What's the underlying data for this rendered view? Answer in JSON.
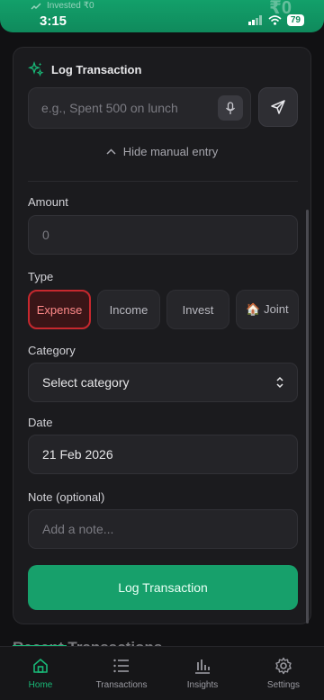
{
  "status_bar": {
    "time": "3:15",
    "battery": "79",
    "ghost_left": "Invested ₹0",
    "ghost_right": "₹0"
  },
  "log_card": {
    "title": "Log Transaction",
    "quick_input_placeholder": "e.g., Spent 500 on lunch",
    "hide_manual_label": "Hide manual entry",
    "amount_label": "Amount",
    "amount_value": "0",
    "type_label": "Type",
    "types": [
      "Expense",
      "Income",
      "Invest",
      "🏠 Joint"
    ],
    "selected_type": "Expense",
    "category_label": "Category",
    "category_value": "Select category",
    "date_label": "Date",
    "date_value": "21 Feb 2026",
    "note_label": "Note (optional)",
    "note_placeholder": "Add a note...",
    "submit_label": "Log Transaction"
  },
  "peek_section_title": "Recent Transactions",
  "nav": {
    "items": [
      {
        "label": "Home",
        "icon": "home-icon",
        "active": true
      },
      {
        "label": "Transactions",
        "icon": "list-icon",
        "active": false
      },
      {
        "label": "Insights",
        "icon": "bar-chart-icon",
        "active": false
      },
      {
        "label": "Settings",
        "icon": "gear-icon",
        "active": false
      }
    ]
  },
  "colors": {
    "accent": "#17a06b",
    "expense": "#c7282e",
    "background": "#111113",
    "card": "#1b1b1e"
  }
}
